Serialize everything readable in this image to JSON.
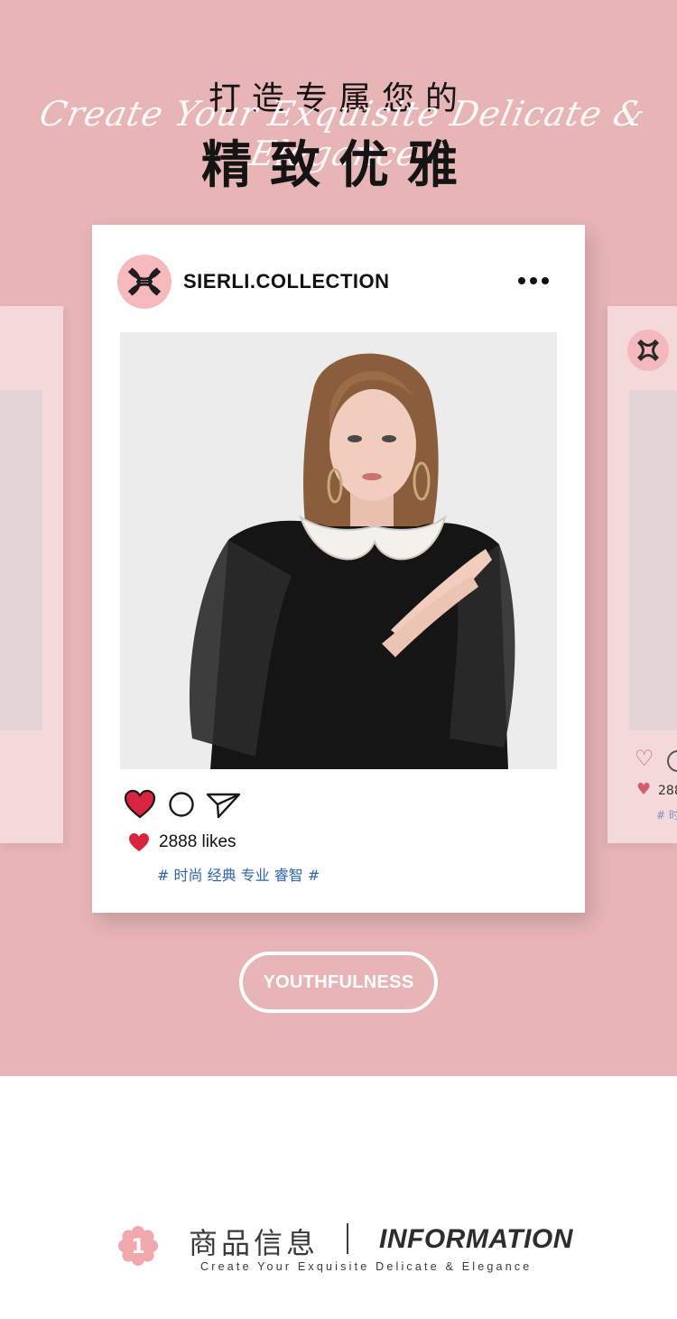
{
  "hero": {
    "title_top": "打造专属您的",
    "script_text": "Create Your Exquisite Delicate & Elegance",
    "title_big": "精致优雅",
    "background": "#e8b5b6"
  },
  "card": {
    "username": "SIERLI.COLLECTION",
    "more_icon": "more-horizontal-icon",
    "likes": "2888 likes",
    "tags": "# 时尚 经典 专业 睿智 #",
    "heart_color": "#d8243f",
    "tag_color": "#2f64ad"
  },
  "ghost_card": {
    "likes": "288",
    "tags": "# 时"
  },
  "button": {
    "label": "YOUTHFULNESS"
  },
  "info": {
    "number": "1",
    "title_cn": "商品信息",
    "title_en": "INFORMATION",
    "subtitle": "Create Your Exquisite Delicate & Elegance"
  }
}
